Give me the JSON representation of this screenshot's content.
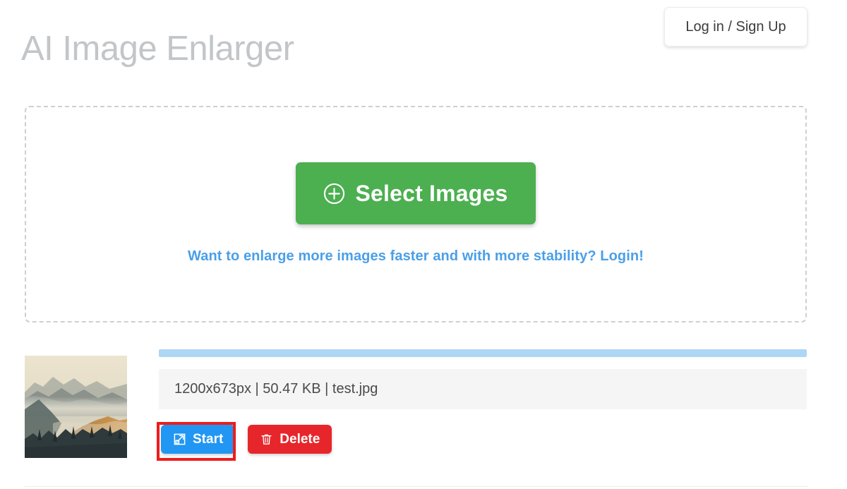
{
  "header": {
    "title": "AI Image Enlarger",
    "login_button_label": "Log in / Sign Up"
  },
  "dropzone": {
    "select_button_label": "Select Images",
    "select_button_icon": "plus-circle-icon",
    "promo_link_text": "Want to enlarge more images faster and with more stability? Login!"
  },
  "file_row": {
    "thumbnail_alt": "misty mountain landscape thumbnail",
    "info_text": "1200x673px | 50.47 KB | test.jpg",
    "dimensions": "1200x673px",
    "size": "50.47 KB",
    "filename": "test.jpg",
    "progress_percent": "100",
    "start_button_label": "Start",
    "start_button_icon": "expand-arrow-icon",
    "delete_button_label": "Delete",
    "delete_button_icon": "trash-icon"
  },
  "colors": {
    "title_gray": "#c2c6c9",
    "green_accent": "#4caf50",
    "link_blue": "#4a9fe8",
    "start_blue": "#2196f3",
    "delete_red": "#e7262c",
    "highlight_red": "#ee1c1c",
    "progress_blue": "#aed6f5",
    "panel_gray": "#f5f5f5"
  }
}
